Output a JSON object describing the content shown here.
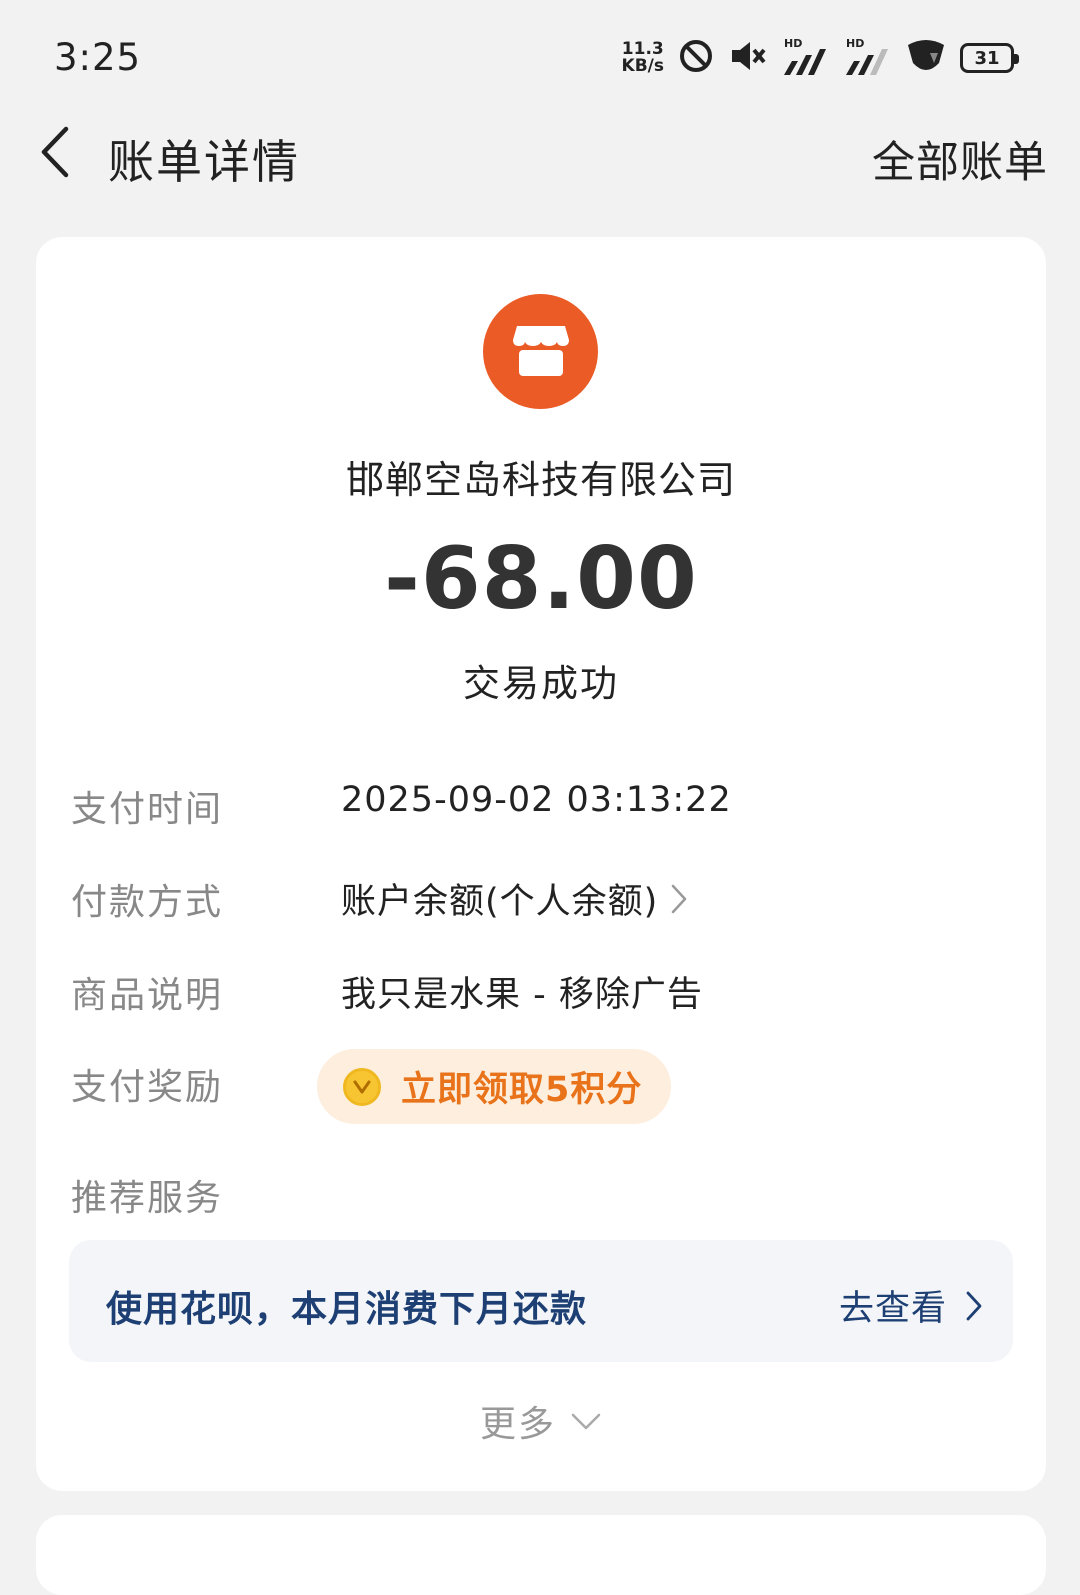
{
  "status_bar": {
    "time": "3:25",
    "net_speed_value": "11.3",
    "net_speed_unit": "KB/s",
    "signal_badge_1": "HD",
    "signal_badge_2": "HD",
    "battery_level": "31",
    "icons": [
      "dnd-icon",
      "mute-icon",
      "signal-icon",
      "signal-icon",
      "wifi-icon",
      "battery-icon"
    ]
  },
  "nav": {
    "title": "账单详情",
    "right_action": "全部账单"
  },
  "merchant": {
    "icon": "store-icon",
    "name": "邯郸空岛科技有限公司",
    "amount": "-68.00",
    "status": "交易成功"
  },
  "details": {
    "rows": [
      {
        "label": "支付时间",
        "value": "2025-09-02 03:13:22"
      },
      {
        "label": "付款方式",
        "value": "账户余额(个人余额)"
      },
      {
        "label": "商品说明",
        "value": "我只是水果 - 移除广告"
      },
      {
        "label": "支付奖励",
        "value": ""
      },
      {
        "label": "推荐服务",
        "value": ""
      }
    ],
    "reward_button": "立即领取5积分"
  },
  "promo": {
    "text": "使用花呗，本月消费下月还款",
    "link": "去查看"
  },
  "more_label": "更多",
  "colors": {
    "accent_orange": "#ea5b26",
    "reward_text": "#e8731a",
    "reward_bg": "#fdeedd",
    "promo_text": "#1d3f73",
    "page_bg": "#f2f2f2"
  }
}
